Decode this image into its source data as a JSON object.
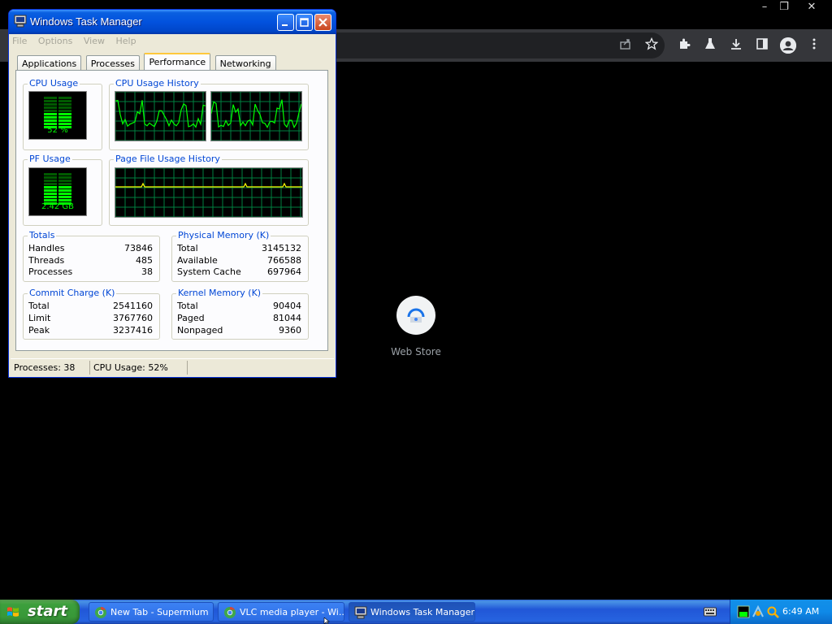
{
  "browser": {
    "window_controls": [
      "–",
      "❐",
      "✕"
    ],
    "toolbar_icons": [
      "share-icon",
      "star-icon",
      "extensions-icon",
      "flask-icon",
      "download-icon",
      "sidepanel-icon",
      "profile-icon",
      "menu-icon"
    ],
    "shortcut": {
      "label": "Web Store"
    }
  },
  "taskmanager": {
    "title": "Windows Task Manager",
    "menu": [
      "File",
      "Options",
      "View",
      "Help"
    ],
    "tabs": [
      "Applications",
      "Processes",
      "Performance",
      "Networking"
    ],
    "active_tab": "Performance",
    "cpu_usage": {
      "label": "CPU Usage",
      "value": "52 %",
      "percent": 52
    },
    "cpu_history": {
      "label": "CPU Usage History"
    },
    "pf_usage": {
      "label": "PF Usage",
      "value": "2.42 GB",
      "fraction": 0.64
    },
    "pf_history": {
      "label": "Page File Usage History"
    },
    "totals": {
      "label": "Totals",
      "rows": [
        {
          "k": "Handles",
          "v": "73846"
        },
        {
          "k": "Threads",
          "v": "485"
        },
        {
          "k": "Processes",
          "v": "38"
        }
      ]
    },
    "physical": {
      "label": "Physical Memory (K)",
      "rows": [
        {
          "k": "Total",
          "v": "3145132"
        },
        {
          "k": "Available",
          "v": "766588"
        },
        {
          "k": "System Cache",
          "v": "697964"
        }
      ]
    },
    "commit": {
      "label": "Commit Charge (K)",
      "rows": [
        {
          "k": "Total",
          "v": "2541160"
        },
        {
          "k": "Limit",
          "v": "3767760"
        },
        {
          "k": "Peak",
          "v": "3237416"
        }
      ]
    },
    "kernel": {
      "label": "Kernel Memory (K)",
      "rows": [
        {
          "k": "Total",
          "v": "90404"
        },
        {
          "k": "Paged",
          "v": "81044"
        },
        {
          "k": "Nonpaged",
          "v": "9360"
        }
      ]
    },
    "status": {
      "processes": "Processes: 38",
      "cpu": "CPU Usage: 52%"
    }
  },
  "taskbar": {
    "start": "start",
    "buttons": [
      {
        "label": "New Tab - Supermium",
        "icon": "chrome-icon"
      },
      {
        "label": "VLC media player - Wi...",
        "icon": "vlc-icon"
      },
      {
        "label": "Windows Task Manager",
        "icon": "taskmanager-icon"
      }
    ],
    "clock": "6:49 AM"
  },
  "colors": {
    "xp_blue": "#0252de",
    "meter_green": "#00ff00",
    "grid_green": "#008040",
    "dialog_bg": "#ece9d8"
  }
}
